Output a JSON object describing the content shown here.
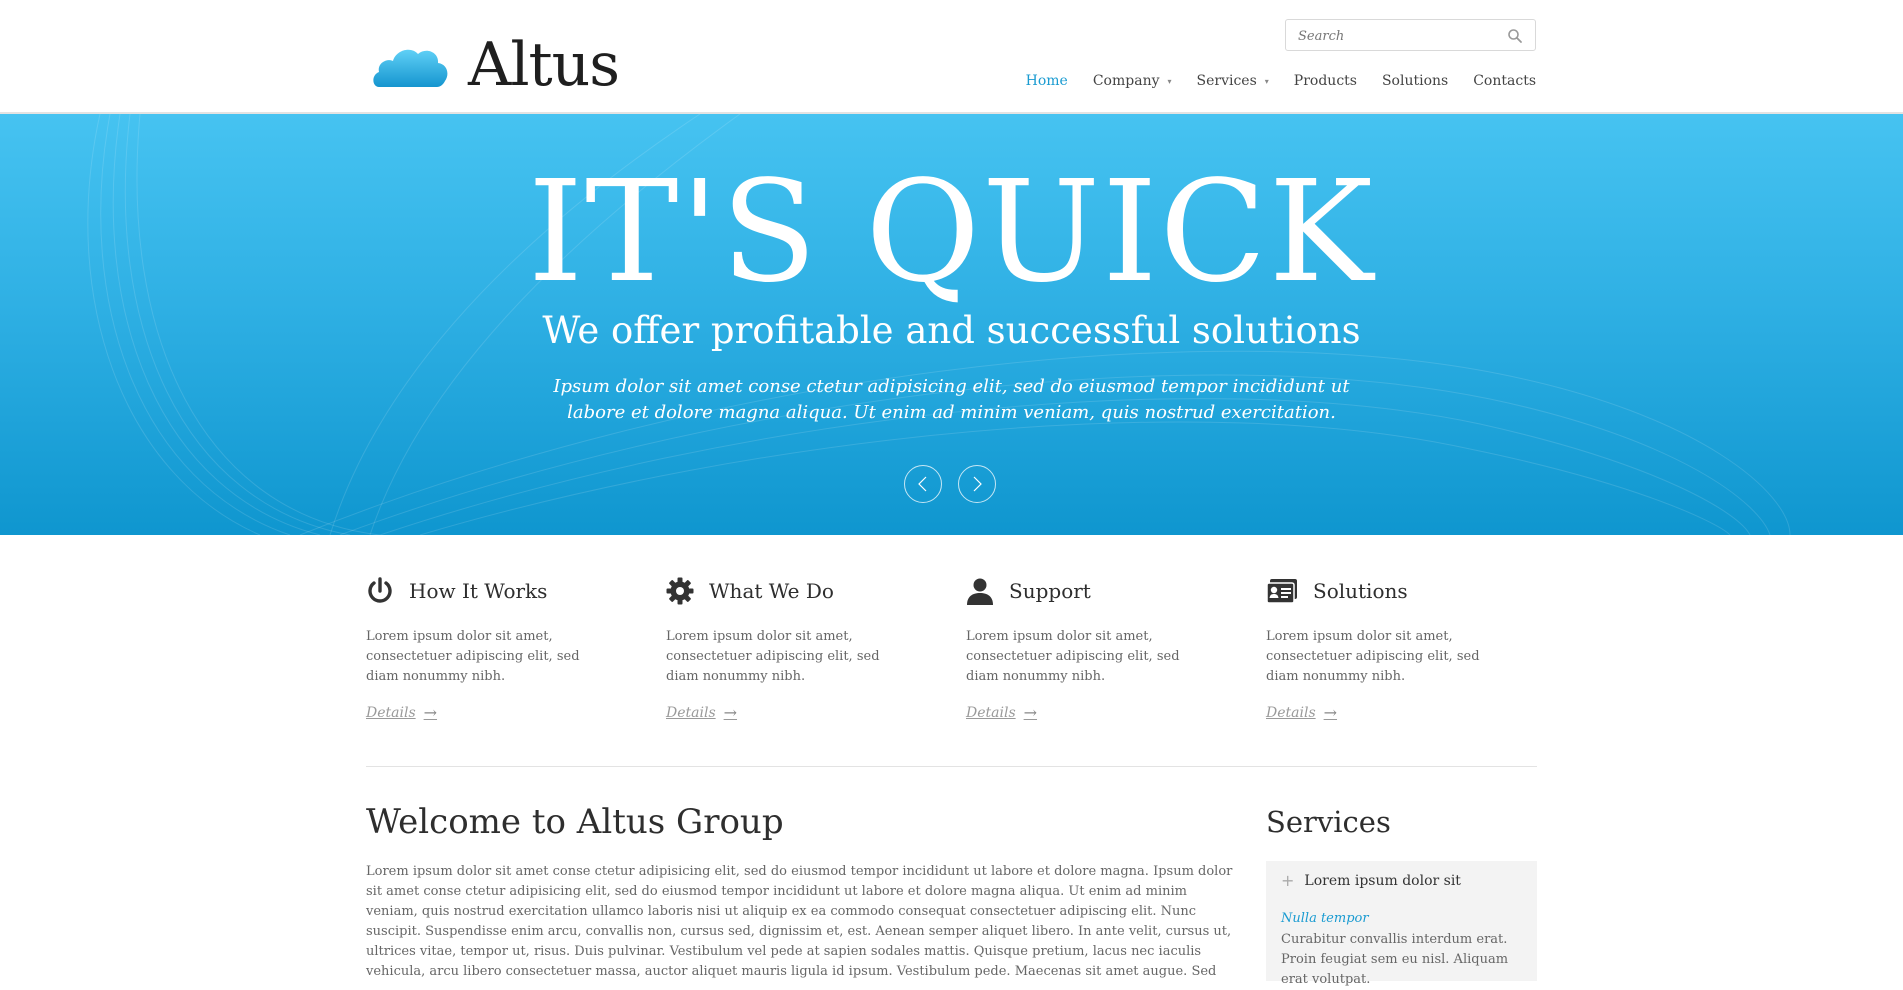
{
  "brand": {
    "name": "Altus",
    "accent_color": "#1a9bd1",
    "logo_icon": "cloud-icon"
  },
  "search": {
    "placeholder": "Search",
    "icon": "search-icon"
  },
  "nav": {
    "items": [
      {
        "label": "Home",
        "active": true,
        "has_dropdown": false
      },
      {
        "label": "Company",
        "active": false,
        "has_dropdown": true
      },
      {
        "label": "Services",
        "active": false,
        "has_dropdown": true
      },
      {
        "label": "Products",
        "active": false,
        "has_dropdown": false
      },
      {
        "label": "Solutions",
        "active": false,
        "has_dropdown": false
      },
      {
        "label": "Contacts",
        "active": false,
        "has_dropdown": false
      }
    ]
  },
  "hero": {
    "title": "IT'S QUICK",
    "subtitle": "We offer profitable and successful solutions",
    "description": "Ipsum dolor sit amet conse ctetur adipisicing elit, sed do eiusmod tempor incididunt ut labore et dolore magna aliqua. Ut enim ad minim veniam, quis nostrud exercitation.",
    "prev_icon": "chevron-left-icon",
    "next_icon": "chevron-right-icon"
  },
  "features": [
    {
      "icon": "power-icon",
      "title": "How It Works",
      "text": "Lorem ipsum dolor sit amet, consectetuer adipiscing elit, sed diam nonummy nibh.",
      "link": "Details"
    },
    {
      "icon": "gear-icon",
      "title": "What We Do",
      "text": "Lorem ipsum dolor sit amet, consectetuer adipiscing elit, sed diam nonummy nibh.",
      "link": "Details"
    },
    {
      "icon": "user-icon",
      "title": "Support",
      "text": "Lorem ipsum dolor sit amet, consectetuer adipiscing elit, sed diam nonummy nibh.",
      "link": "Details"
    },
    {
      "icon": "id-card-icon",
      "title": "Solutions",
      "text": "Lorem ipsum dolor sit amet, consectetuer adipiscing elit, sed diam nonummy nibh.",
      "link": "Details"
    }
  ],
  "welcome": {
    "title": "Welcome to Altus Group",
    "text": "Lorem ipsum dolor sit amet conse ctetur adipisicing elit, sed do eiusmod tempor incididunt ut labore et dolore magna. Ipsum dolor sit amet conse ctetur adipisicing elit, sed do eiusmod tempor incididunt ut labore et dolore magna aliqua. Ut enim ad minim veniam, quis nostrud exercitation ullamco laboris nisi ut aliquip ex ea commodo consequat consectetuer adipiscing elit. Nunc suscipit. Suspendisse enim arcu, convallis non, cursus sed, dignissim et, est. Aenean semper aliquet libero. In ante velit, cursus ut, ultrices vitae, tempor ut, risus. Duis pulvinar. Vestibulum vel pede at sapien sodales mattis. Quisque pretium, lacus nec iaculis vehicula, arcu libero consectetuer massa, auctor aliquet mauris ligula id ipsum. Vestibulum pede. Maecenas sit amet augue. Sed"
  },
  "services": {
    "title": "Services",
    "item_label": "Lorem ipsum dolor sit",
    "item_sub": "Nulla tempor",
    "item_text": "Curabitur convallis interdum erat. Proin feugiat sem eu nisl. Aliquam erat volutpat."
  }
}
